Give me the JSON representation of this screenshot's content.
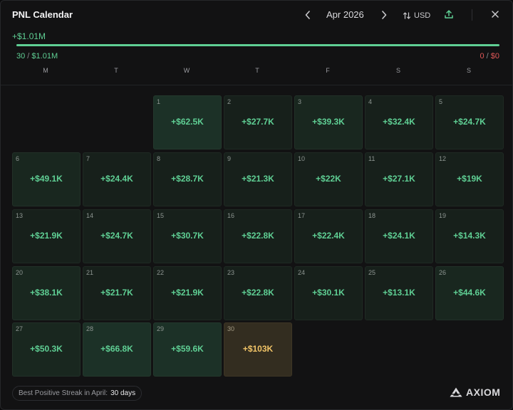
{
  "header": {
    "title": "PNL Calendar",
    "month": "Apr 2026",
    "prev_icon": "chevron-left-icon",
    "next_icon": "chevron-right-icon",
    "currency": "USD",
    "currency_icon": "sort-arrows-icon",
    "share_icon": "share-upload-icon",
    "close_icon": "close-icon"
  },
  "summary": {
    "total": "+$1.01M",
    "positive_days": "30",
    "positive_amount": "$1.01M",
    "negative_days": "0",
    "negative_amount": "$0",
    "positive_fraction": 1.0,
    "positive_color": "#5fcf94",
    "negative_color": "#e05757"
  },
  "weekdays": [
    "M",
    "T",
    "W",
    "T",
    "F",
    "S",
    "S"
  ],
  "first_weekday_index": 2,
  "days": [
    {
      "day": "1",
      "pnl": "+$62.5K",
      "tone": "strong"
    },
    {
      "day": "2",
      "pnl": "+$27.7K",
      "tone": "low"
    },
    {
      "day": "3",
      "pnl": "+$39.3K",
      "tone": "mid"
    },
    {
      "day": "4",
      "pnl": "+$32.4K",
      "tone": "low"
    },
    {
      "day": "5",
      "pnl": "+$24.7K",
      "tone": "low"
    },
    {
      "day": "6",
      "pnl": "+$49.1K",
      "tone": "mid"
    },
    {
      "day": "7",
      "pnl": "+$24.4K",
      "tone": "low"
    },
    {
      "day": "8",
      "pnl": "+$28.7K",
      "tone": "low"
    },
    {
      "day": "9",
      "pnl": "+$21.3K",
      "tone": "low"
    },
    {
      "day": "10",
      "pnl": "+$22K",
      "tone": "low"
    },
    {
      "day": "11",
      "pnl": "+$27.1K",
      "tone": "low"
    },
    {
      "day": "12",
      "pnl": "+$19K",
      "tone": "low"
    },
    {
      "day": "13",
      "pnl": "+$21.9K",
      "tone": "low"
    },
    {
      "day": "14",
      "pnl": "+$24.7K",
      "tone": "low"
    },
    {
      "day": "15",
      "pnl": "+$30.7K",
      "tone": "low"
    },
    {
      "day": "16",
      "pnl": "+$22.8K",
      "tone": "low"
    },
    {
      "day": "17",
      "pnl": "+$22.4K",
      "tone": "low"
    },
    {
      "day": "18",
      "pnl": "+$24.1K",
      "tone": "low"
    },
    {
      "day": "19",
      "pnl": "+$14.3K",
      "tone": "low"
    },
    {
      "day": "20",
      "pnl": "+$38.1K",
      "tone": "mid"
    },
    {
      "day": "21",
      "pnl": "+$21.7K",
      "tone": "low"
    },
    {
      "day": "22",
      "pnl": "+$21.9K",
      "tone": "low"
    },
    {
      "day": "23",
      "pnl": "+$22.8K",
      "tone": "low"
    },
    {
      "day": "24",
      "pnl": "+$30.1K",
      "tone": "low"
    },
    {
      "day": "25",
      "pnl": "+$13.1K",
      "tone": "low"
    },
    {
      "day": "26",
      "pnl": "+$44.6K",
      "tone": "mid"
    },
    {
      "day": "27",
      "pnl": "+$50.3K",
      "tone": "mid"
    },
    {
      "day": "28",
      "pnl": "+$66.8K",
      "tone": "strong"
    },
    {
      "day": "29",
      "pnl": "+$59.6K",
      "tone": "strong"
    },
    {
      "day": "30",
      "pnl": "+$103K",
      "tone": "best"
    }
  ],
  "footer": {
    "streak_label": "Best Positive Streak in April:",
    "streak_value": "30 days",
    "brand": "AXIOM",
    "brand_icon": "axiom-logo-icon"
  }
}
